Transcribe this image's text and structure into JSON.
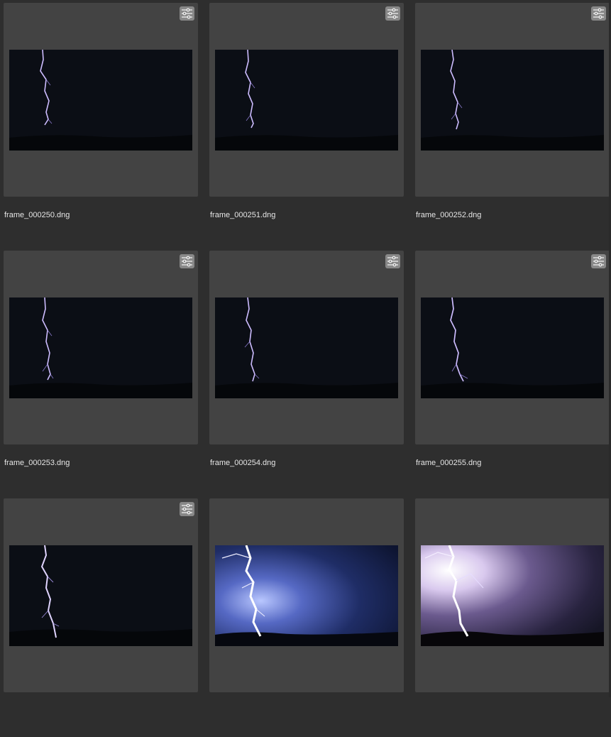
{
  "photos": [
    {
      "filename": "frame_000250.dng",
      "edited": true,
      "scene": "dim"
    },
    {
      "filename": "frame_000251.dng",
      "edited": true,
      "scene": "dim"
    },
    {
      "filename": "frame_000252.dng",
      "edited": true,
      "scene": "dim"
    },
    {
      "filename": "frame_000253.dng",
      "edited": true,
      "scene": "dim"
    },
    {
      "filename": "frame_000254.dng",
      "edited": true,
      "scene": "dim"
    },
    {
      "filename": "frame_000255.dng",
      "edited": true,
      "scene": "dim"
    },
    {
      "filename": "",
      "edited": true,
      "scene": "dim"
    },
    {
      "filename": "",
      "edited": false,
      "scene": "bright-blue"
    },
    {
      "filename": "",
      "edited": false,
      "scene": "bright-violet"
    }
  ],
  "icons": {
    "edit_badge": "sliders-icon"
  },
  "colors": {
    "background": "#2e2e2e",
    "card": "#434343",
    "badge": "#888888",
    "text": "#e6e6e6"
  }
}
